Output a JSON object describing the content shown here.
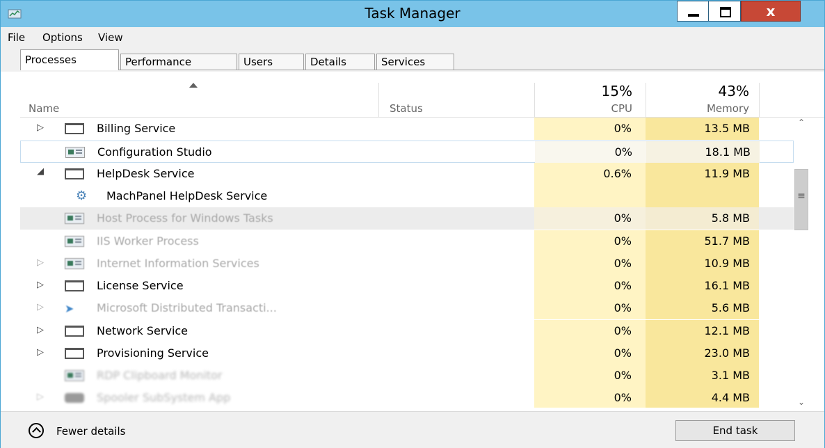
{
  "window": {
    "title": "Task Manager",
    "close_glyph": "x"
  },
  "menu": [
    "File",
    "Options",
    "View"
  ],
  "tabs": [
    "Processes",
    "Performance",
    "Users",
    "Details",
    "Services"
  ],
  "columns": {
    "name": "Name",
    "status": "Status",
    "cpu_pct": "15%",
    "cpu": "CPU",
    "mem_pct": "43%",
    "memory": "Memory"
  },
  "rows": [
    {
      "name": "Billing Service",
      "cpu": "0%",
      "mem": "13.5 MB"
    },
    {
      "name": "Configuration Studio",
      "cpu": "0%",
      "mem": "18.1 MB"
    },
    {
      "name": "HelpDesk Service",
      "cpu": "0.6%",
      "mem": "11.9 MB"
    },
    {
      "name": "MachPanel HelpDesk Service",
      "cpu": "",
      "mem": ""
    },
    {
      "name": "Host Process for Windows Tasks",
      "cpu": "0%",
      "mem": "5.8 MB"
    },
    {
      "name": "IIS Worker Process",
      "cpu": "0%",
      "mem": "51.7 MB"
    },
    {
      "name": "Internet Information Services",
      "cpu": "0%",
      "mem": "10.9 MB"
    },
    {
      "name": "License Service",
      "cpu": "0%",
      "mem": "16.1 MB"
    },
    {
      "name": "Microsoft Distributed Transacti...",
      "cpu": "0%",
      "mem": "5.6 MB"
    },
    {
      "name": "Network Service",
      "cpu": "0%",
      "mem": "12.1 MB"
    },
    {
      "name": "Provisioning Service",
      "cpu": "0%",
      "mem": "23.0 MB"
    },
    {
      "name": "RDP Clipboard Monitor",
      "cpu": "0%",
      "mem": "3.1 MB"
    },
    {
      "name": "Spooler SubSystem App",
      "cpu": "0%",
      "mem": "4.4 MB"
    }
  ],
  "footer": {
    "fewer_details": "Fewer details",
    "end_task": "End task"
  },
  "colors": {
    "titlebar": "#79c3e8",
    "cpu_heat": "#fff4c4",
    "mem_heat": "#f9e79c",
    "close": "#c74836"
  },
  "icons": [
    "app-window-icon",
    "service-gear-icon",
    "distributed-transaction-icon"
  ]
}
